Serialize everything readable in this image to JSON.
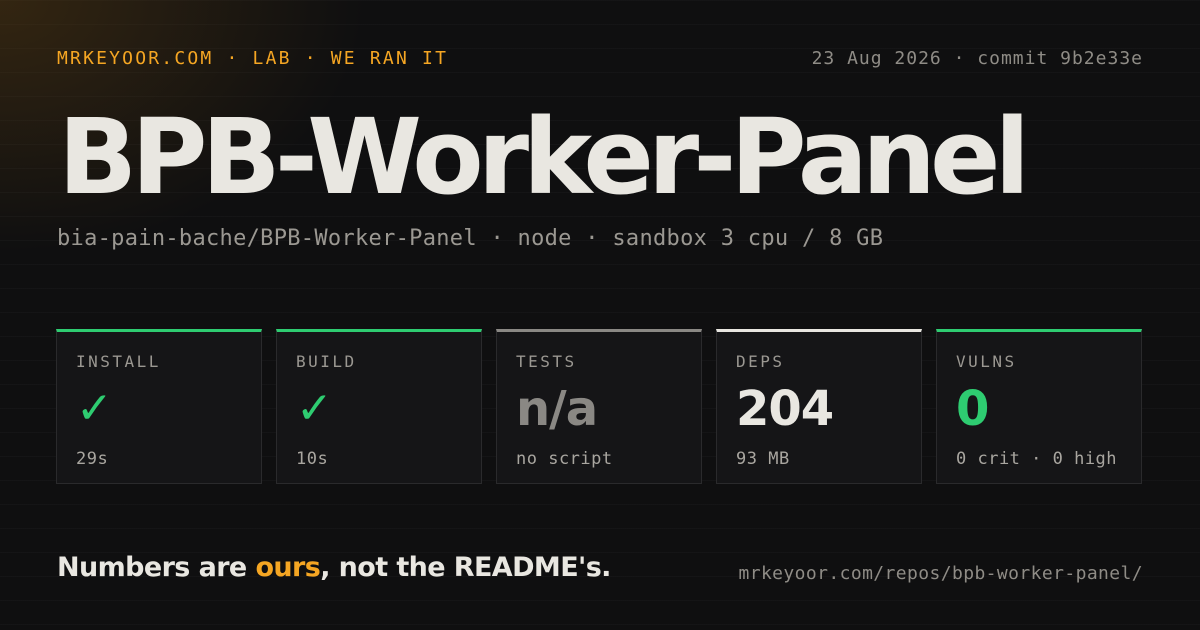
{
  "header": {
    "brand": "MRKEYOOR.COM · LAB · WE RAN IT",
    "meta": "23 Aug 2026 · commit 9b2e33e"
  },
  "repo": {
    "title": "BPB-Worker-Panel",
    "subtitle": "bia-pain-bache/BPB-Worker-Panel · node · sandbox 3 cpu / 8 GB"
  },
  "colors": {
    "accent": "#f5a623",
    "pass": "#2ecc71",
    "neutral": "#8a8884",
    "text": "#e9e7e1",
    "background": "#0f0f10"
  },
  "stats": [
    {
      "label": "INSTALL",
      "value": "✓",
      "sub": "29s",
      "status": "pass",
      "icon": "checkmark-icon"
    },
    {
      "label": "BUILD",
      "value": "✓",
      "sub": "10s",
      "status": "pass",
      "icon": "checkmark-icon"
    },
    {
      "label": "TESTS",
      "value": "n/a",
      "sub": "no script",
      "status": "neutral"
    },
    {
      "label": "DEPS",
      "value": "204",
      "sub": "93 MB",
      "status": "info"
    },
    {
      "label": "VULNS",
      "value": "0",
      "sub": "0 crit · 0 high",
      "status": "pass"
    }
  ],
  "footer": {
    "tagline_pre": "Numbers are ",
    "tagline_accent": "ours",
    "tagline_post": ", not the README's.",
    "url": "mrkeyoor.com/repos/bpb-worker-panel/"
  }
}
